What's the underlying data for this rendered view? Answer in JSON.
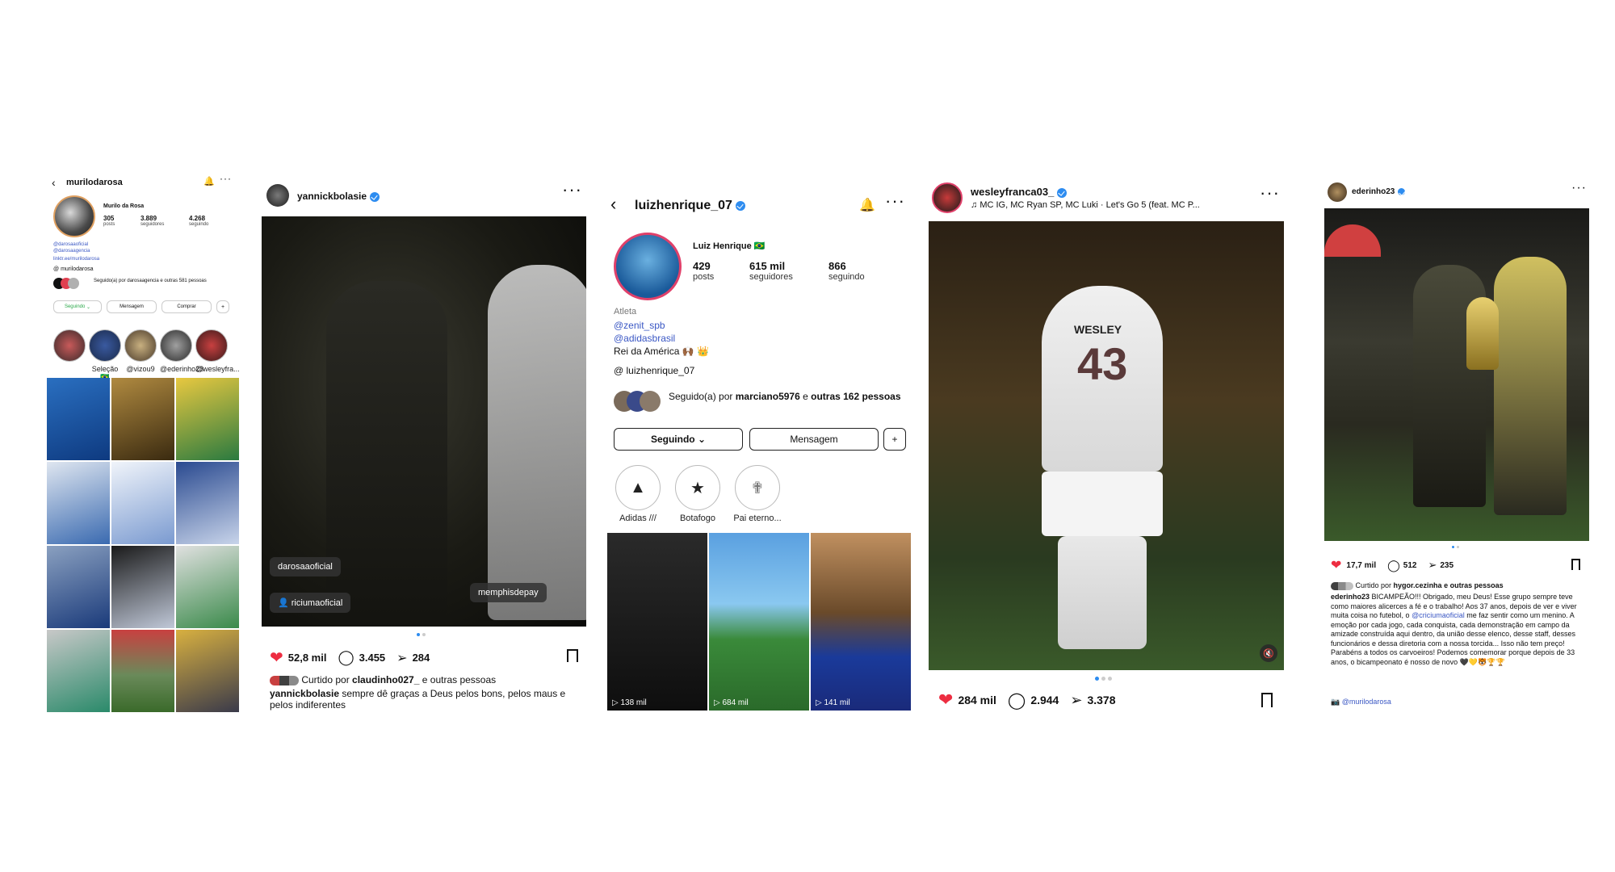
{
  "panel1": {
    "username": "murilodarosa",
    "display_name": "Murilo da Rosa",
    "posts_num": "305",
    "posts_lbl": "posts",
    "followers_num": "3.889",
    "followers_lbl": "seguidores",
    "following_num": "4.268",
    "following_lbl": "seguindo",
    "link1": "@darosaaoficial",
    "link2": "@darosaagencia",
    "link3": "linktr.ee/murilodarosa",
    "threads": "murilodarosa",
    "followed_by": "Seguido(a) por darosaagencia e outras 581 pessoas",
    "btn_following": "Seguindo",
    "btn_message": "Mensagem",
    "btn_buy": "Comprar",
    "stories": [
      "",
      "Seleção🇧🇷",
      "@vizou9",
      "@ederinho23",
      "@wesleyfra..."
    ]
  },
  "panel2": {
    "username": "yannickbolasie",
    "tag1": "darosaaoficial",
    "tag2": "riciumaoficial",
    "tag3": "memphisdepay",
    "likes": "52,8 mil",
    "comments": "3.455",
    "shares": "284",
    "liked_by_prefix": "Curtido por ",
    "liked_by_user": "claudinho027_",
    "liked_by_suffix": " e outras pessoas",
    "caption_user": "yannickbolasie",
    "caption_text": " sempre dê graças a Deus pelos bons, pelos maus e pelos indiferentes"
  },
  "panel3": {
    "username": "luizhenrique_07",
    "display_name": "Luiz Henrique 🇧🇷",
    "posts_num": "429",
    "posts_lbl": "posts",
    "followers_num": "615 mil",
    "followers_lbl": "seguidores",
    "following_num": "866",
    "following_lbl": "seguindo",
    "category": "Atleta",
    "link1": "@zenit_spb",
    "link2": "@adidasbrasil",
    "bio": "Rei da América 🙌🏾 👑",
    "threads": "luizhenrique_07",
    "followed_by_prefix": "Seguido(a) por ",
    "followed_by_user": "marciano5976",
    "followed_by_mid": " e ",
    "followed_by_rest": "outras 162 pessoas",
    "btn_following": "Seguindo",
    "btn_message": "Mensagem",
    "highlights": [
      "Adidas ///",
      "Botafogo",
      "Pai eterno..."
    ],
    "views": [
      "138 mil",
      "684 mil",
      "141 mil"
    ]
  },
  "panel4": {
    "username": "wesleyfranca03_",
    "music": "MC IG, MC Ryan SP, MC Luki · Let's Go 5 (feat. MC P...",
    "likes": "284 mil",
    "comments": "2.944",
    "shares": "3.378",
    "jersey_name": "WESLEY",
    "jersey_number": "43"
  },
  "panel5": {
    "username": "ederinho23",
    "likes": "17,7 mil",
    "comments": "512",
    "shares": "235",
    "liked_by_prefix": "Curtido por ",
    "liked_by_user": "hygor.cezinha",
    "liked_by_suffix": " e outras pessoas",
    "caption_user": "ederinho23",
    "caption_text_1": " BICAMPEÃO!!! Obrigado, meu Deus! Esse grupo sempre teve como maiores alicerces a fé e o trabalho! Aos 37 anos, depois de ver e viver muita coisa no futebol, o ",
    "caption_mention": "@criciumaoficial",
    "caption_text_2": " me faz sentir como um menino. A emoção por cada jogo, cada conquista, cada demonstração em campo da amizade construída aqui dentro, da união desse elenco, desse staff, desses funcionários e dessa diretoria com a nossa torcida... Isso não tem preço! Parabéns a todos os carvoeiros! Podemos comemorar porque depois de 33 anos, o bicampeonato é nosso de novo 🖤💛🐯🏆🏆",
    "tagged": "@murilodarosa"
  },
  "colors": {
    "like_red": "#ed2d41",
    "link_blue": "#3a57c4",
    "verified_blue": "#2d8cf0",
    "follow_green": "#2ba84a"
  }
}
